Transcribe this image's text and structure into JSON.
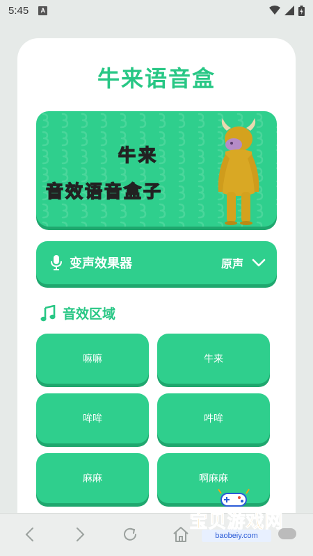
{
  "status_bar": {
    "time": "5:45",
    "notification_letter": "A"
  },
  "app": {
    "title": "牛来语音盒"
  },
  "banner": {
    "line1": "牛来",
    "line2": "音效语音盒子"
  },
  "voice_changer": {
    "label": "变声效果器",
    "value": "原声"
  },
  "sound_section": {
    "title": "音效区域",
    "buttons": [
      {
        "label": "嘛嘛"
      },
      {
        "label": "牛来"
      },
      {
        "label": "哞哞"
      },
      {
        "label": "吽哞"
      },
      {
        "label": "麻麻"
      },
      {
        "label": "啊麻麻"
      }
    ]
  },
  "watermark": {
    "text": "宝贝游戏网",
    "url": "baobeiy.com"
  },
  "colors": {
    "accent": "#2fcf8d",
    "accent_dark": "#1fa76e",
    "title_green": "#28c785",
    "watermark_orange": "#f2a516"
  }
}
